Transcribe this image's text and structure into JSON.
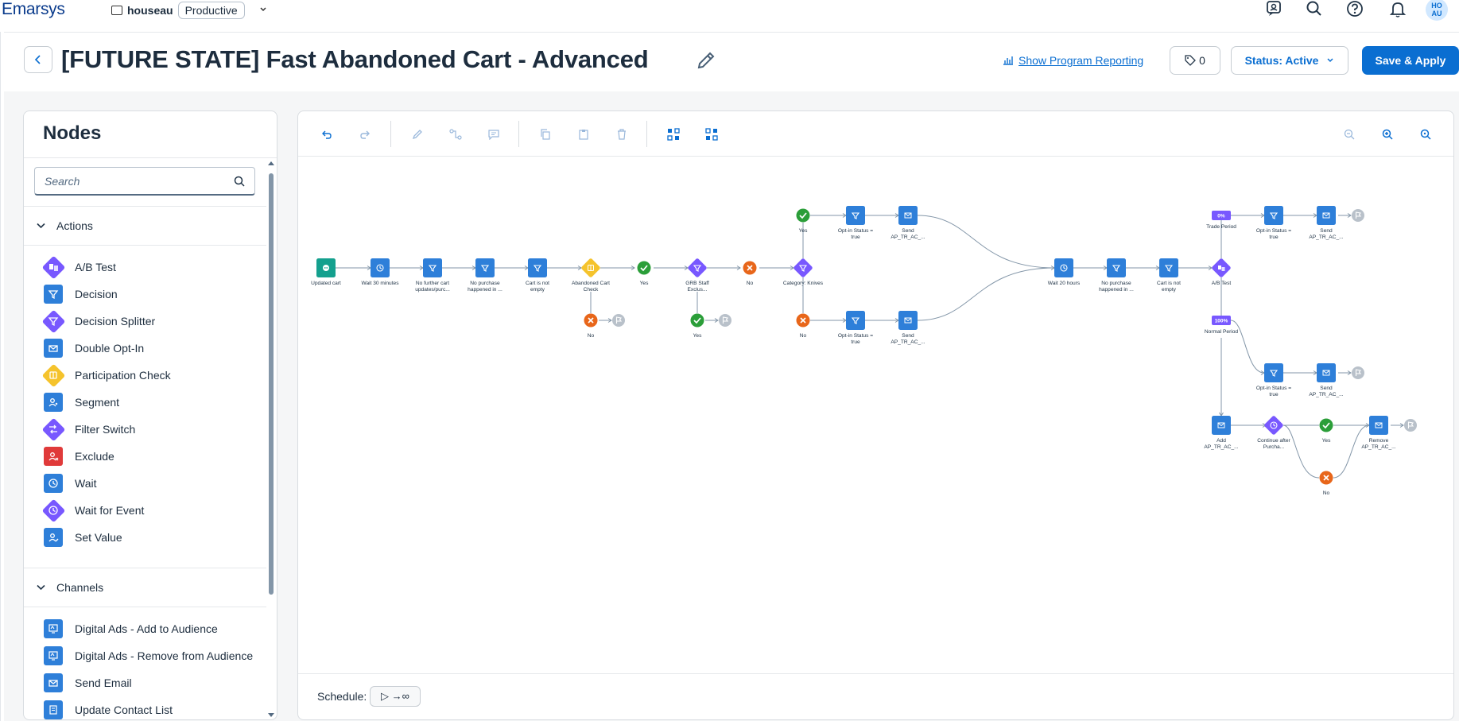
{
  "app": {
    "logo": "Emarsys",
    "account": "houseau",
    "environment": "Productive",
    "avatar": "HO AU"
  },
  "header": {
    "title": "[FUTURE STATE] Fast Abandoned Cart - Advanced",
    "reporting_link": "Show Program Reporting",
    "tag_count": "0",
    "status_label": "Status: Active",
    "save_label": "Save & Apply"
  },
  "nodes_panel": {
    "title": "Nodes",
    "search_placeholder": "Search",
    "sections": [
      {
        "label": "Actions",
        "items": [
          {
            "label": "A/B Test",
            "icon": "ab-test-icon",
            "color": "#7858ff",
            "shape": "diamond"
          },
          {
            "label": "Decision",
            "icon": "funnel-icon",
            "color": "#2e7fd9",
            "shape": "square"
          },
          {
            "label": "Decision Splitter",
            "icon": "funnel-icon",
            "color": "#7858ff",
            "shape": "diamond"
          },
          {
            "label": "Double Opt-In",
            "icon": "envelope-icon",
            "color": "#2e7fd9",
            "shape": "square"
          },
          {
            "label": "Participation Check",
            "icon": "participation-icon",
            "color": "#f5c32c",
            "shape": "diamond"
          },
          {
            "label": "Segment",
            "icon": "person-icon",
            "color": "#2e7fd9",
            "shape": "square"
          },
          {
            "label": "Filter Switch",
            "icon": "switch-icon",
            "color": "#7858ff",
            "shape": "diamond"
          },
          {
            "label": "Exclude",
            "icon": "person-x-icon",
            "color": "#e03a3a",
            "shape": "square"
          },
          {
            "label": "Wait",
            "icon": "clock-icon",
            "color": "#2e7fd9",
            "shape": "square"
          },
          {
            "label": "Wait for Event",
            "icon": "clock-icon",
            "color": "#7858ff",
            "shape": "diamond"
          },
          {
            "label": "Set Value",
            "icon": "person-edit-icon",
            "color": "#2e7fd9",
            "shape": "square"
          }
        ]
      },
      {
        "label": "Channels",
        "items": [
          {
            "label": "Digital Ads - Add to Audience",
            "icon": "ads-icon",
            "color": "#2e7fd9",
            "shape": "square"
          },
          {
            "label": "Digital Ads - Remove from Audience",
            "icon": "ads-icon",
            "color": "#2e7fd9",
            "shape": "square"
          },
          {
            "label": "Send Email",
            "icon": "envelope-icon",
            "color": "#2e7fd9",
            "shape": "square"
          },
          {
            "label": "Update Contact List",
            "icon": "list-icon",
            "color": "#2e7fd9",
            "shape": "square"
          }
        ]
      }
    ]
  },
  "schedule": {
    "label": "Schedule:",
    "value": "▷ →∞"
  },
  "flow": {
    "labels": {
      "updated_cart": "Updated cart",
      "wait30": "Wait 30 minutes",
      "no_further_1": "No further cart",
      "no_further_2": "updates/purc...",
      "no_purchase_1": "No purchase",
      "no_purchase_2": "happened in ...",
      "cart_not_1": "Cart is not",
      "cart_not_2": "empty",
      "abandoned_1": "Abandoned Cart",
      "abandoned_2": "Check",
      "yes": "Yes",
      "no": "No",
      "grb_1": "GRB Staff",
      "grb_2": "Exclus...",
      "category": "Category: Knives",
      "optin_1": "Opt-in Status =",
      "optin_2": "true",
      "send_1": "Send",
      "send_2": "AP_TR_AC_...",
      "wait20": "Wait 20 hours",
      "ab_test": "A/B Test",
      "trade_period": "Trade Period",
      "normal_period": "Normal Period",
      "pct0": "0%",
      "pct100": "100%",
      "add_1": "Add",
      "add_2": "AP_TR_AC_...",
      "continue_1": "Continue after",
      "continue_2": "Purcha...",
      "remove_1": "Remove",
      "remove_2": "AP_TR_AC_..."
    }
  },
  "colors": {
    "accent": "#0a6ed1",
    "node_blue": "#2e7fd9",
    "node_purple": "#7858ff",
    "node_yellow": "#f5c32c",
    "node_teal": "#14a08e",
    "yes_green": "#2b9e39",
    "no_orange": "#e8661a",
    "exit_gray": "#b9c1ca"
  }
}
